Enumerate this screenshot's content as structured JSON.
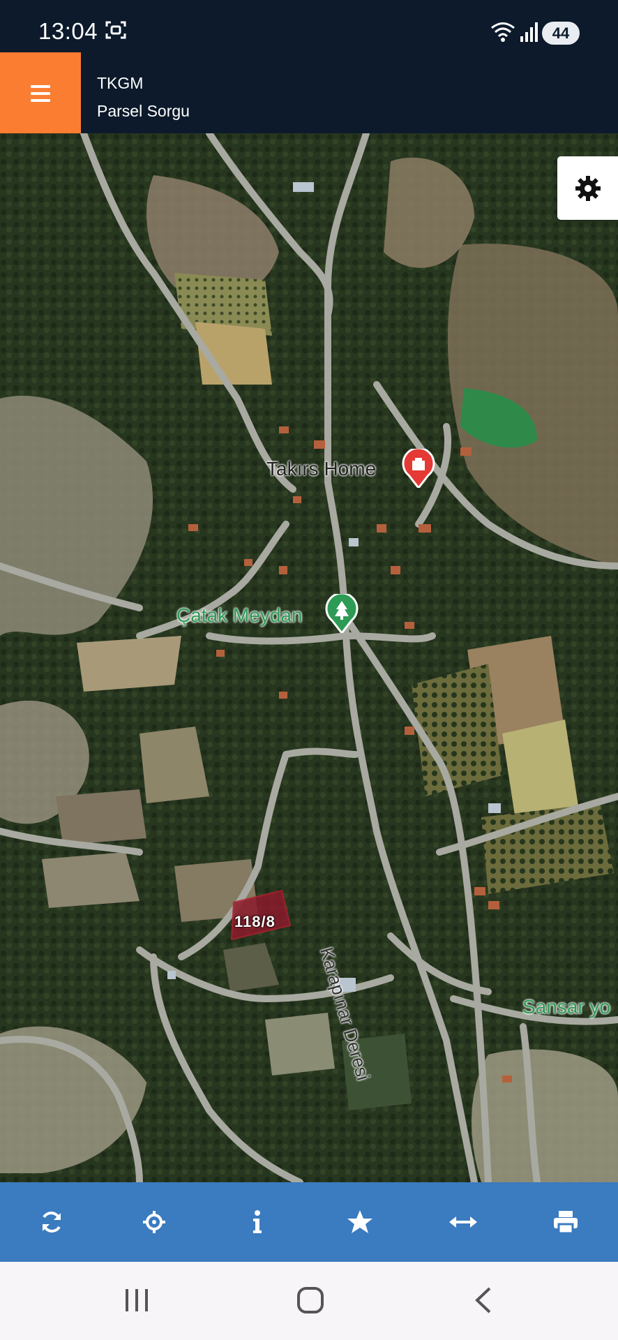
{
  "status_bar": {
    "time": "13:04",
    "battery": "44",
    "icons": [
      "screenshot-icon",
      "wifi-icon",
      "signal-icon",
      "battery-icon"
    ]
  },
  "app_bar": {
    "title": "TKGM",
    "subtitle": "Parsel Sorgu",
    "menu_icon": "hamburger-menu-icon",
    "accent_color": "#fa7d31",
    "background_color": "#0c1a2b"
  },
  "map": {
    "places": [
      {
        "name": "Takırs Home",
        "icon": "hotel-pin-icon",
        "color": "#e53935"
      },
      {
        "name": "Çatak Meydan",
        "icon": "park-pin-icon",
        "color": "#2d9b55"
      },
      {
        "name": "Sansar yo",
        "icon": "none",
        "color": "#2d9b55"
      }
    ],
    "road_label": "Karapınar Deresi",
    "parcel": {
      "label": "118/8",
      "color": "#8b1a2b"
    },
    "settings_icon": "gear-icon"
  },
  "toolbar": {
    "background_color": "#3b7bbf",
    "tools": [
      {
        "name": "refresh",
        "icon": "refresh-icon"
      },
      {
        "name": "locate",
        "icon": "crosshair-icon"
      },
      {
        "name": "info",
        "icon": "info-icon"
      },
      {
        "name": "favorites",
        "icon": "star-icon"
      },
      {
        "name": "measure",
        "icon": "horizontal-arrows-icon"
      },
      {
        "name": "print",
        "icon": "print-icon"
      }
    ]
  },
  "nav_bar": {
    "buttons": [
      "recent-apps-icon",
      "home-icon",
      "back-icon"
    ]
  }
}
